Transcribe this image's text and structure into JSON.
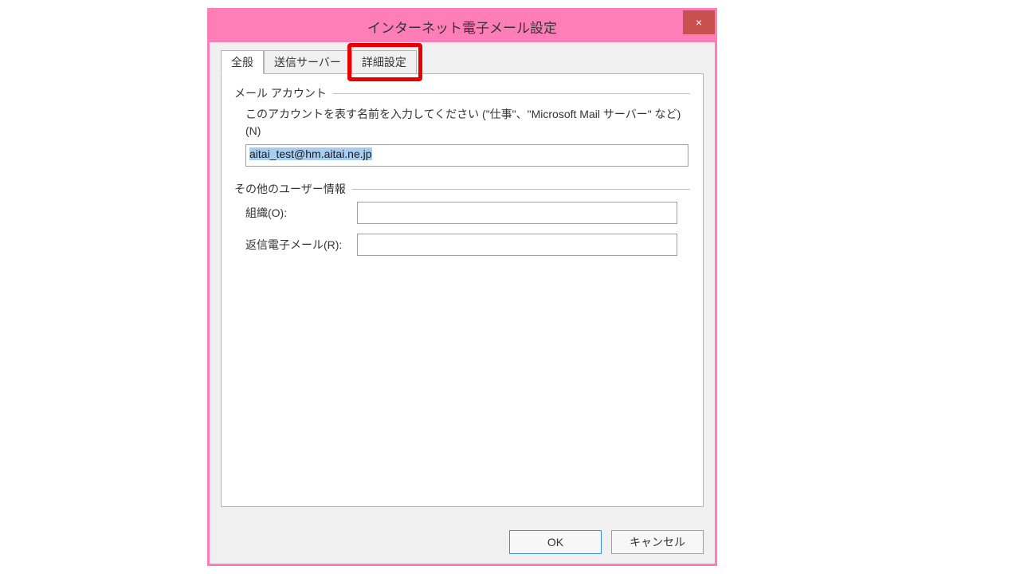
{
  "titlebar": {
    "title": "インターネット電子メール設定",
    "close": "×"
  },
  "tabs": {
    "general": "全般",
    "outgoing": "送信サーバー",
    "advanced": "詳細設定"
  },
  "mail_account": {
    "legend": "メール アカウント",
    "description": "このアカウントを表す名前を入力してください (\"仕事\"、\"Microsoft Mail サーバー\" など)(N)",
    "value": "aitai_test@hm.aitai.ne.jp"
  },
  "other_user": {
    "legend": "その他のユーザー情報",
    "org_label": "組織(O):",
    "org_value": "",
    "reply_label": "返信電子メール(R):",
    "reply_value": ""
  },
  "buttons": {
    "ok": "OK",
    "cancel": "キャンセル"
  }
}
